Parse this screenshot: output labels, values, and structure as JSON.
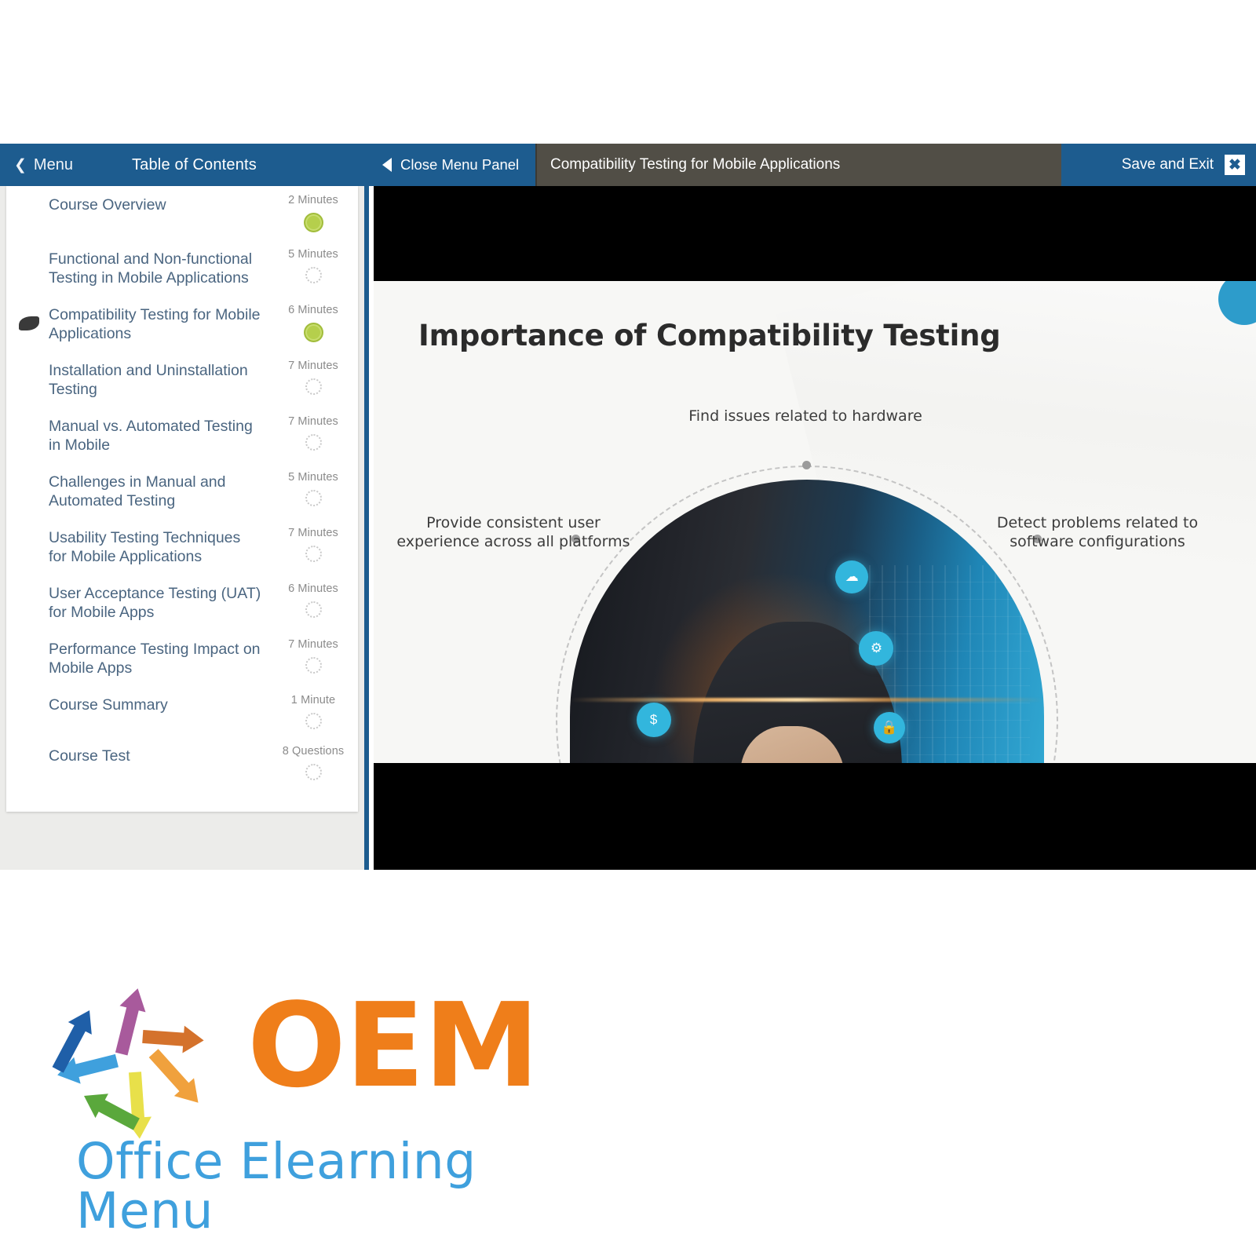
{
  "topbar": {
    "menu_label": "Menu",
    "menu_icon": "chevron-left-icon",
    "toc_label": "Table of Contents",
    "close_panel_label": "Close Menu Panel",
    "close_panel_icon": "triangle-left-icon",
    "lesson_title": "Compatibility Testing for Mobile Applications",
    "save_exit_label": "Save and Exit",
    "close_icon": "close-x-icon",
    "accent_color": "#1d5c8f",
    "title_bg_color": "#514e46"
  },
  "sidebar": {
    "items": [
      {
        "title": "Course Overview",
        "duration": "2 Minutes",
        "status": "done",
        "current": false
      },
      {
        "title": "Functional and Non-functional Testing in Mobile Applications",
        "duration": "5 Minutes",
        "status": "todo",
        "current": false
      },
      {
        "title": "Compatibility Testing for Mobile Applications",
        "duration": "6 Minutes",
        "status": "done",
        "current": true
      },
      {
        "title": "Installation and Uninstallation Testing",
        "duration": "7 Minutes",
        "status": "todo",
        "current": false
      },
      {
        "title": "Manual vs. Automated Testing in Mobile",
        "duration": "7 Minutes",
        "status": "todo",
        "current": false
      },
      {
        "title": "Challenges in Manual and Automated Testing",
        "duration": "5 Minutes",
        "status": "todo",
        "current": false
      },
      {
        "title": "Usability Testing Techniques for Mobile Applications",
        "duration": "7 Minutes",
        "status": "todo",
        "current": false
      },
      {
        "title": "User Acceptance Testing (UAT) for Mobile Apps",
        "duration": "6 Minutes",
        "status": "todo",
        "current": false
      },
      {
        "title": "Performance Testing Impact on Mobile Apps",
        "duration": "7 Minutes",
        "status": "todo",
        "current": false
      },
      {
        "title": "Course Summary",
        "duration": "1 Minute",
        "status": "todo",
        "current": false
      },
      {
        "title": "Course Test",
        "duration": "8 Questions",
        "status": "todo",
        "current": false
      }
    ],
    "status_done_color": "#b5cf4c",
    "status_todo_color": "#c9c9c9"
  },
  "slide": {
    "title": "Importance of Compatibility Testing",
    "captions": {
      "top": "Find issues related to hardware",
      "left": "Provide consistent user experience across all platforms",
      "right": "Detect problems related to software configurations"
    },
    "image_alt": "person holding smartphone with digital data overlay",
    "accent_dot_color": "#2d9ccb",
    "overlay_icons": [
      "cloud-icon",
      "gear-icon",
      "dollar-icon",
      "lock-icon",
      "phone-icon",
      "wrench-icon"
    ]
  },
  "logo": {
    "brand": "OEM",
    "tagline": "Office Elearning Menu",
    "brand_color": "#ef7e1a",
    "tagline_color": "#3fa0dd",
    "arrow_colors": [
      "#3fa0dd",
      "#1f5fa8",
      "#a85a9c",
      "#d4722c",
      "#f0a13d",
      "#e8e04a",
      "#5aa83c"
    ]
  }
}
